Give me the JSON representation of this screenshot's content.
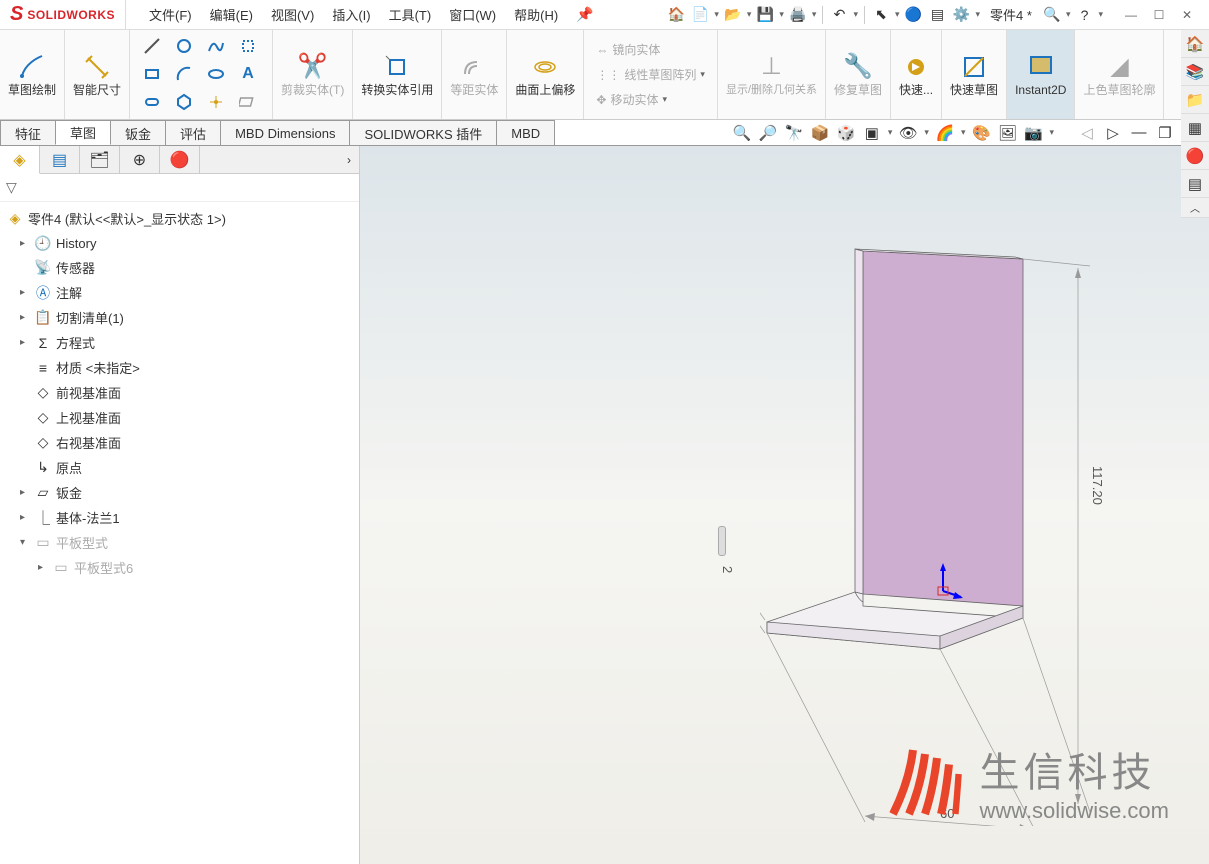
{
  "app": {
    "logo_text": "SOLIDWORKS",
    "doc_name": "零件4 *"
  },
  "menu": {
    "file": "文件(F)",
    "edit": "编辑(E)",
    "view": "视图(V)",
    "insert": "插入(I)",
    "tools": "工具(T)",
    "window": "窗口(W)",
    "help": "帮助(H)"
  },
  "ribbon": {
    "sketch": "草图绘制",
    "smart_dim": "智能尺寸",
    "trim": "剪裁实体(T)",
    "convert": "转换实体引用",
    "offset_body": "等距实体",
    "surface_offset": "曲面上偏移",
    "mirror": "镜向实体",
    "linear_pattern": "线性草图阵列",
    "move": "移动实体",
    "display_rel": "显示/删除几何关系",
    "repair": "修复草图",
    "rapid": "快速...",
    "rapid_sketch": "快速草图",
    "instant2d": "Instant2D",
    "shaded": "上色草图轮廓"
  },
  "tabs": {
    "feature": "特征",
    "sketch": "草图",
    "sheetmetal": "钣金",
    "evaluate": "评估",
    "mbd_dim": "MBD Dimensions",
    "sw_addins": "SOLIDWORKS 插件",
    "mbd": "MBD"
  },
  "tree": {
    "root": "零件4  (默认<<默认>_显示状态 1>)",
    "history": "History",
    "sensors": "传感器",
    "annotations": "注解",
    "cutlist": "切割清单(1)",
    "equations": "方程式",
    "material": "材质 <未指定>",
    "front_plane": "前视基准面",
    "top_plane": "上视基准面",
    "right_plane": "右视基准面",
    "origin": "原点",
    "sheetmetal_feat": "钣金",
    "base_flange": "基体-法兰1",
    "flat_pattern": "平板型式",
    "flat_pattern6": "平板型式6"
  },
  "dims": {
    "height": "117.20",
    "width": "60",
    "thickness": "2"
  },
  "watermark": {
    "cn": "生信科技",
    "url": "www.solidwise.com"
  }
}
